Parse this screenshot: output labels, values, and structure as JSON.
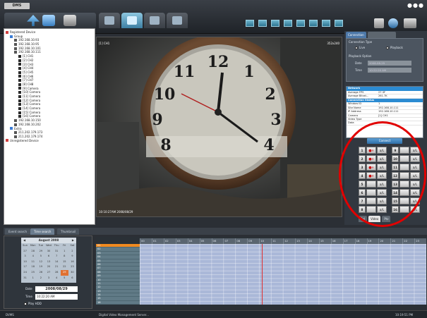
{
  "app": {
    "logo": "DMS",
    "window_controls": "●●●"
  },
  "toolbar": {
    "main_tabs": [
      "live",
      "search",
      "playback",
      "setup"
    ],
    "layout_buttons": 8
  },
  "tree": {
    "root_label": "Registered Device",
    "items": [
      {
        "label": "Registered Device",
        "indent": 0,
        "icon": "folder-icon"
      },
      {
        "label": "Group",
        "indent": 1,
        "icon": "group-icon"
      },
      {
        "label": "192.168.10.93",
        "indent": 2,
        "icon": "dvr-icon"
      },
      {
        "label": "192.168.10.95",
        "indent": 2,
        "icon": "dvr-icon"
      },
      {
        "label": "192.168.10.101",
        "indent": 2,
        "icon": "dvr-icon"
      },
      {
        "label": "192.168.10.111",
        "indent": 2,
        "icon": "dvr-icon"
      },
      {
        "label": "[1] CH1",
        "indent": 3,
        "icon": "camera-icon"
      },
      {
        "label": "[2] CH2",
        "indent": 3,
        "icon": "camera-icon"
      },
      {
        "label": "[3] CH3",
        "indent": 3,
        "icon": "camera-icon"
      },
      {
        "label": "[4] CH4",
        "indent": 3,
        "icon": "camera-icon"
      },
      {
        "label": "[5] CH5",
        "indent": 3,
        "icon": "camera-icon"
      },
      {
        "label": "[6] CH6",
        "indent": 3,
        "icon": "camera-icon"
      },
      {
        "label": "[7] CH7",
        "indent": 3,
        "icon": "camera-icon"
      },
      {
        "label": "[8] CH8",
        "indent": 3,
        "icon": "camera-icon"
      },
      {
        "label": "[9] Camera",
        "indent": 3,
        "icon": "camera-icon"
      },
      {
        "label": "[10] Camera",
        "indent": 3,
        "icon": "camera-icon"
      },
      {
        "label": "[11] Camera",
        "indent": 3,
        "icon": "camera-icon"
      },
      {
        "label": "[12] Camera",
        "indent": 3,
        "icon": "camera-icon"
      },
      {
        "label": "[13] Camera",
        "indent": 3,
        "icon": "camera-icon"
      },
      {
        "label": "[14] Camera",
        "indent": 3,
        "icon": "camera-icon"
      },
      {
        "label": "[15] Camera",
        "indent": 3,
        "icon": "camera-icon"
      },
      {
        "label": "[16] Camera",
        "indent": 3,
        "icon": "camera-icon"
      },
      {
        "label": "192.168.10.150",
        "indent": 2,
        "icon": "dvr-icon"
      },
      {
        "label": "192.168.10.202",
        "indent": 2,
        "icon": "dvr-icon"
      },
      {
        "label": "Extra",
        "indent": 1,
        "icon": "group-icon"
      },
      {
        "label": "211.202.179.173",
        "indent": 2,
        "icon": "dvr-icon"
      },
      {
        "label": "211.202.179.174",
        "indent": 2,
        "icon": "dvr-icon"
      },
      {
        "label": "Unregistered Device",
        "indent": 0,
        "icon": "folder-icon"
      }
    ]
  },
  "video": {
    "channel_label": "[1] CH1",
    "resolution": "352x240",
    "timestamp": "10:10:27AM 2008/08/29"
  },
  "right_panel": {
    "tab_connection": "Connection",
    "tab_other": "",
    "connection_type_label": "Connection Type",
    "opt_live": "Live",
    "opt_playback": "Playback",
    "playback_option_label": "Playback Option",
    "date_label": "Date",
    "date_value": "2008-08-29",
    "time_label": "Time",
    "time_value": "10:22:20 AM",
    "network_header": "Network",
    "network_rows": [
      {
        "k": "Average FPS",
        "v": "27.3F"
      },
      {
        "k": "Average Bitrat...",
        "v": "261.7K"
      }
    ],
    "status_header": "Connection Status",
    "status_rows": [
      {
        "k": "Window ID",
        "v": "1"
      },
      {
        "k": "Site Name",
        "v": "192.168.10.111"
      },
      {
        "k": "IP Address",
        "v": "192.168.10.111"
      },
      {
        "k": "Camera",
        "v": "[1] CH1"
      },
      {
        "k": "Video Type",
        "v": ""
      },
      {
        "k": "Data",
        "v": ""
      }
    ],
    "connect_label": "Connect",
    "bottom_tabs": [
      "Sel",
      "Video",
      "Ptz"
    ]
  },
  "channels": [
    {
      "num": "1",
      "rec": "●»",
      "au": "a/L"
    },
    {
      "num": "2",
      "rec": "●»",
      "au": "a/L"
    },
    {
      "num": "3",
      "rec": "●»",
      "au": "a/L"
    },
    {
      "num": "4",
      "rec": "●»",
      "au": "a/L"
    },
    {
      "num": "5",
      "rec": "",
      "au": "a/L"
    },
    {
      "num": "6",
      "rec": "",
      "au": "a/L"
    },
    {
      "num": "7",
      "rec": "",
      "au": "a/L"
    },
    {
      "num": "8",
      "rec": "",
      "au": "a/L"
    },
    {
      "num": "9",
      "rec": "",
      "au": "a/L"
    },
    {
      "num": "10",
      "rec": "",
      "au": "a/L"
    },
    {
      "num": "11",
      "rec": "",
      "au": "a/L"
    },
    {
      "num": "12",
      "rec": "",
      "au": "a/L"
    },
    {
      "num": "13",
      "rec": "",
      "au": "a/L"
    },
    {
      "num": "14",
      "rec": "",
      "au": "a/L"
    },
    {
      "num": "15",
      "rec": "",
      "au": "a/L"
    },
    {
      "num": "16",
      "rec": "",
      "au": "a/L"
    }
  ],
  "bottom_tabs": [
    "Event search",
    "Time search",
    "Thumbnail"
  ],
  "calendar": {
    "month_label": "August 2008",
    "weekdays": [
      "Sun",
      "Mon",
      "Tue",
      "Wed",
      "Thu",
      "Fri",
      "Sat"
    ],
    "weeks": [
      [
        "27",
        "28",
        "29",
        "30",
        "31",
        "1",
        "2"
      ],
      [
        "3",
        "4",
        "5",
        "6",
        "7",
        "8",
        "9"
      ],
      [
        "10",
        "11",
        "12",
        "13",
        "14",
        "15",
        "16"
      ],
      [
        "17",
        "18",
        "19",
        "20",
        "21",
        "22",
        "23"
      ],
      [
        "24",
        "25",
        "26",
        "27",
        "28",
        "29",
        "30"
      ],
      [
        "31",
        "1",
        "2",
        "3",
        "4",
        "5",
        "6"
      ]
    ],
    "selected_day": "29"
  },
  "search_fields": {
    "date_label": "Date",
    "date_value": "2008/08/29",
    "time_label": "Time",
    "time_value": "10:22:20 AM",
    "play_label": "Play HDD"
  },
  "timeline": {
    "hours": [
      "00",
      "01",
      "02",
      "03",
      "04",
      "05",
      "06",
      "07",
      "08",
      "09",
      "10",
      "11",
      "12",
      "13",
      "14",
      "15",
      "16",
      "17",
      "18",
      "19",
      "20",
      "21",
      "22",
      "23"
    ],
    "channels": [
      "01",
      "02",
      "03",
      "04",
      "05",
      "06",
      "07",
      "08",
      "09",
      "10",
      "11",
      "12",
      "13",
      "14",
      "15",
      "16"
    ],
    "selected": "01"
  },
  "status": {
    "left": "DVMS",
    "middle": "Digital Video Management Server...",
    "right": "10:19:51 PM"
  }
}
